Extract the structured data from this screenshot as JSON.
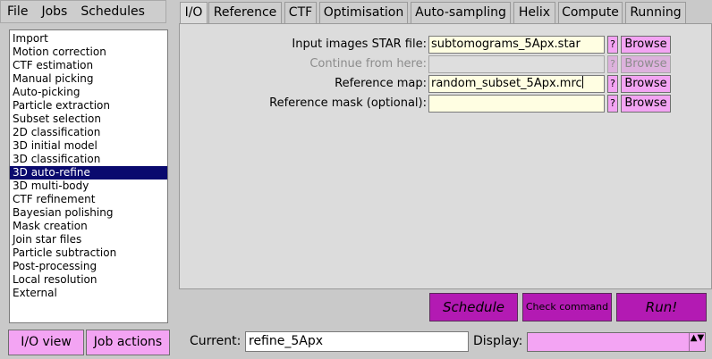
{
  "menu": [
    "File",
    "Jobs",
    "Schedules"
  ],
  "job_types": [
    "Import",
    "Motion correction",
    "CTF estimation",
    "Manual picking",
    "Auto-picking",
    "Particle extraction",
    "Subset selection",
    "2D classification",
    "3D initial model",
    "3D classification",
    "3D auto-refine",
    "3D multi-body",
    "CTF refinement",
    "Bayesian polishing",
    "Mask creation",
    "Join star files",
    "Particle subtraction",
    "Post-processing",
    "Local resolution",
    "External"
  ],
  "selected_job": "3D auto-refine",
  "left_buttons": {
    "io_view": "I/O view",
    "job_actions": "Job actions"
  },
  "tabs": [
    "I/O",
    "Reference",
    "CTF",
    "Optimisation",
    "Auto-sampling",
    "Helix",
    "Compute",
    "Running"
  ],
  "active_tab": "I/O",
  "fields": [
    {
      "label": "Input images STAR file:",
      "value": "subtomograms_5Apx.star",
      "help": "?",
      "browse": "Browse",
      "disabled": false
    },
    {
      "label": "Continue from here:",
      "value": "",
      "help": "?",
      "browse": "Browse",
      "disabled": true
    },
    {
      "label": "Reference map:",
      "value": "random_subset_5Apx.mrc",
      "help": "?",
      "browse": "Browse",
      "disabled": false
    },
    {
      "label": "Reference mask (optional):",
      "value": "",
      "help": "?",
      "browse": "Browse",
      "disabled": false
    }
  ],
  "actions": {
    "schedule": "Schedule",
    "check_command": "Check command",
    "run": "Run!"
  },
  "current": {
    "label": "Current:",
    "value": "refine_5Apx"
  },
  "display": {
    "label": "Display:",
    "value": "",
    "arrow": "▲▼"
  },
  "colors": {
    "accent": "#f3a4f3",
    "action": "#b31ab3",
    "selection": "#0a0a6e",
    "input_bg": "#fffee2"
  }
}
